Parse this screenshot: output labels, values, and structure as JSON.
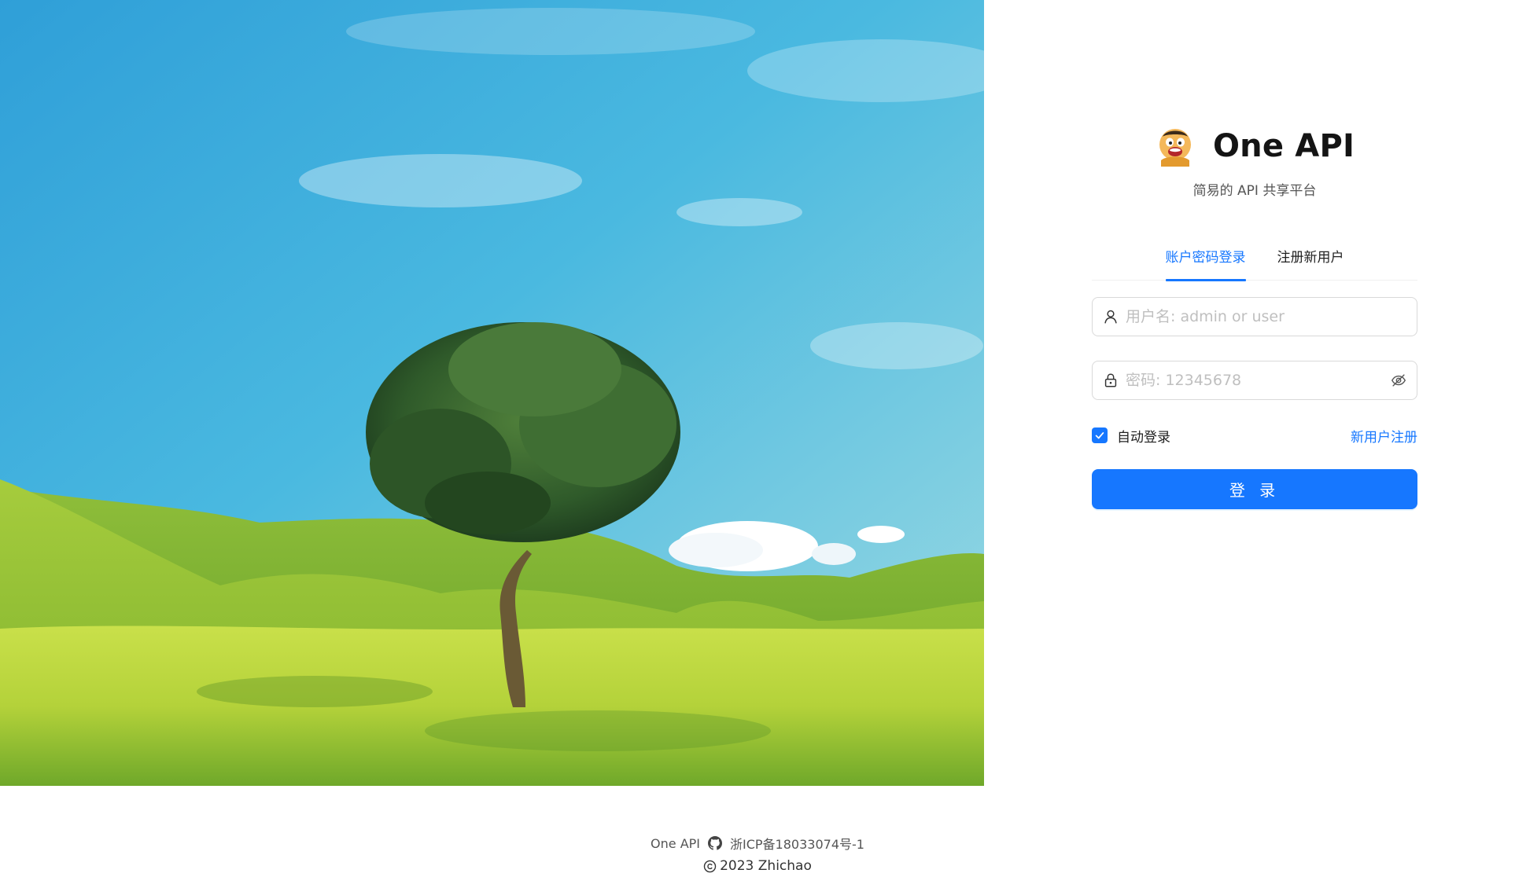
{
  "brand": {
    "title": "One API",
    "subtitle": "简易的 API 共享平台",
    "logo_icon": "cartoon-avatar-logo"
  },
  "tabs": [
    {
      "label": "账户密码登录",
      "active": true
    },
    {
      "label": "注册新用户",
      "active": false
    }
  ],
  "login_form": {
    "username_placeholder": "用户名: admin or user",
    "username_value": "",
    "password_placeholder": "密码: 12345678",
    "password_value": "",
    "auto_login_label": "自动登录",
    "auto_login_checked": true,
    "register_link": "新用户注册",
    "submit_label": "登 录"
  },
  "footer": {
    "site_name": "One API",
    "github_icon": "github-icon",
    "icp": "浙ICP备18033074号-1",
    "copyright_year": "2023 Zhichao"
  },
  "colors": {
    "accent": "#1677ff",
    "text": "#1f1f1f",
    "muted": "#555555",
    "placeholder": "#bfbfbf",
    "border": "#d9d9d9"
  }
}
